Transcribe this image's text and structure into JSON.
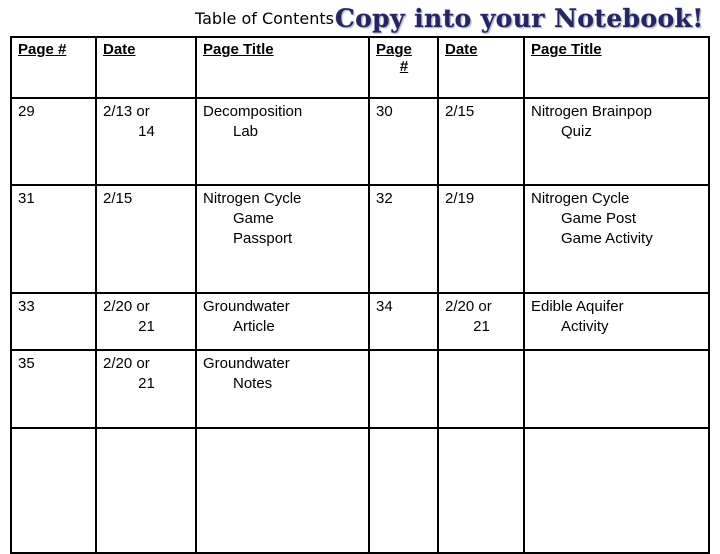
{
  "slide": {
    "background_color": "#ffffff",
    "title_plain": "Table of Contents",
    "title_wordart": "Copy into your Notebook!",
    "wordart_color": "#252562",
    "wordart_outline_color": "#8a8ab4"
  },
  "table": {
    "headers": [
      {
        "line1": "Page #",
        "line2": ""
      },
      {
        "line1": "Date",
        "line2": ""
      },
      {
        "line1": "Page Title",
        "line2": ""
      },
      {
        "line1": "Page",
        "line2": "#"
      },
      {
        "line1": "Date",
        "line2": ""
      },
      {
        "line1": "Page Title",
        "line2": ""
      }
    ],
    "rows": [
      {
        "page_left": {
          "l1": "29",
          "l2": "",
          "l3": ""
        },
        "date_left": {
          "l1": "2/13 or",
          "l2": "14",
          "l3": ""
        },
        "title_left": {
          "l1": "Decomposition",
          "l2": "Lab",
          "l3": ""
        },
        "page_right": {
          "l1": "30",
          "l2": "",
          "l3": ""
        },
        "date_right": {
          "l1": "2/15",
          "l2": "",
          "l3": ""
        },
        "title_right": {
          "l1": "Nitrogen Brainpop",
          "l2": "Quiz",
          "l3": ""
        }
      },
      {
        "page_left": {
          "l1": "31",
          "l2": "",
          "l3": ""
        },
        "date_left": {
          "l1": "2/15",
          "l2": "",
          "l3": ""
        },
        "title_left": {
          "l1": "Nitrogen Cycle",
          "l2": "Game",
          "l3": "Passport"
        },
        "page_right": {
          "l1": "32",
          "l2": "",
          "l3": ""
        },
        "date_right": {
          "l1": "2/19",
          "l2": "",
          "l3": ""
        },
        "title_right": {
          "l1": "Nitrogen Cycle",
          "l2": "Game Post",
          "l3": "Game Activity"
        }
      },
      {
        "page_left": {
          "l1": "33",
          "l2": "",
          "l3": ""
        },
        "date_left": {
          "l1": "2/20 or",
          "l2": "21",
          "l3": ""
        },
        "title_left": {
          "l1": "Groundwater",
          "l2": "Article",
          "l3": ""
        },
        "page_right": {
          "l1": "34",
          "l2": "",
          "l3": ""
        },
        "date_right": {
          "l1": "2/20 or",
          "l2": "21",
          "l3": ""
        },
        "title_right": {
          "l1": "Edible Aquifer",
          "l2": "Activity",
          "l3": ""
        }
      },
      {
        "page_left": {
          "l1": "35",
          "l2": "",
          "l3": ""
        },
        "date_left": {
          "l1": "2/20 or",
          "l2": "21",
          "l3": ""
        },
        "title_left": {
          "l1": "Groundwater",
          "l2": "Notes",
          "l3": ""
        },
        "page_right": {
          "l1": "",
          "l2": "",
          "l3": ""
        },
        "date_right": {
          "l1": "",
          "l2": "",
          "l3": ""
        },
        "title_right": {
          "l1": "",
          "l2": "",
          "l3": ""
        }
      },
      {
        "page_left": {
          "l1": "",
          "l2": "",
          "l3": ""
        },
        "date_left": {
          "l1": "",
          "l2": "",
          "l3": ""
        },
        "title_left": {
          "l1": "",
          "l2": "",
          "l3": ""
        },
        "page_right": {
          "l1": "",
          "l2": "",
          "l3": ""
        },
        "date_right": {
          "l1": "",
          "l2": "",
          "l3": ""
        },
        "title_right": {
          "l1": "",
          "l2": "",
          "l3": ""
        }
      }
    ]
  }
}
